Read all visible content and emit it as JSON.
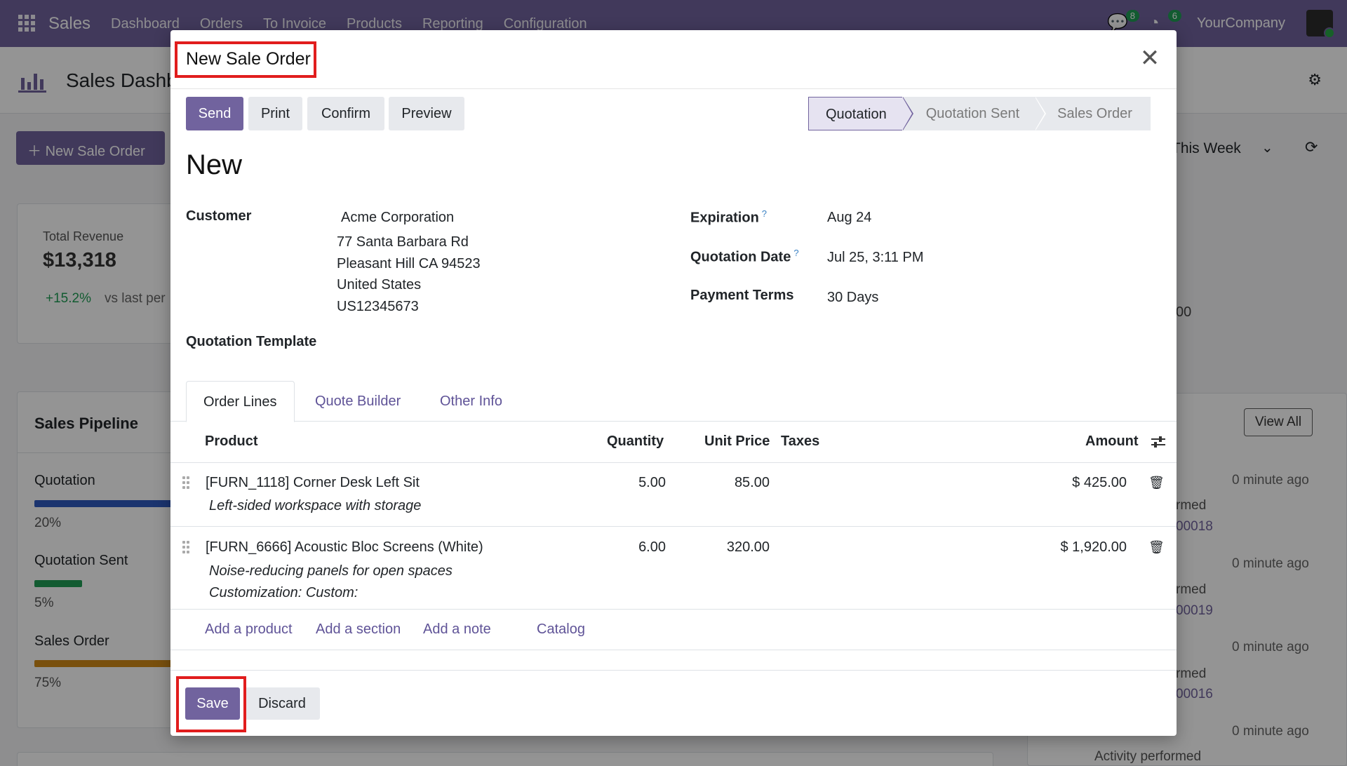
{
  "app": {
    "name": "Sales",
    "menu": [
      "Dashboard",
      "Orders",
      "To Invoice",
      "Products",
      "Reporting",
      "Configuration"
    ],
    "messages_count": "8",
    "activities_count": "6",
    "company": "YourCompany"
  },
  "dashboard": {
    "title": "Sales Dashb",
    "new_order_label": "New Sale Order",
    "period": "This Week",
    "revenue": {
      "label": "Total Revenue",
      "value": "$13,318",
      "delta": "+15.2%",
      "vs": "vs last per"
    },
    "pipeline": {
      "title": "Sales Pipeline",
      "stages": [
        {
          "name": "Quotation",
          "pct": "20%",
          "color": "#2f5bbf"
        },
        {
          "name": "Quotation Sent",
          "pct": "5%",
          "color": "#1f9d55"
        },
        {
          "name": "Sales Order",
          "pct": "75%",
          "color": "#d08b17"
        }
      ]
    },
    "view_all": "View All",
    "partial_number": "00",
    "activities": [
      {
        "time": "0 minute ago",
        "text": "rmed",
        "ref": "00018"
      },
      {
        "time": "0 minute ago",
        "text": "rmed",
        "ref": "00019"
      },
      {
        "time": "0 minute ago",
        "text": "rmed",
        "ref": "00016"
      },
      {
        "time": "0 minute ago",
        "text": "Activity performed",
        "ref": ""
      }
    ]
  },
  "modal": {
    "title": "New Sale Order",
    "buttons": {
      "send": "Send",
      "print": "Print",
      "confirm": "Confirm",
      "preview": "Preview"
    },
    "stages": [
      "Quotation",
      "Quotation Sent",
      "Sales Order"
    ],
    "record_name": "New",
    "customer": {
      "label": "Customer",
      "name": "Acme Corporation",
      "address": [
        "77 Santa Barbara Rd",
        "Pleasant Hill CA 94523",
        "United States",
        "US12345673"
      ]
    },
    "quotation_template_label": "Quotation Template",
    "expiration": {
      "label": "Expiration",
      "help": "?",
      "value": "Aug 24"
    },
    "quotation_date": {
      "label": "Quotation Date",
      "help": "?",
      "value": "Jul 25, 3:11 PM"
    },
    "payment_terms": {
      "label": "Payment Terms",
      "value": "30 Days"
    },
    "tabs": [
      "Order Lines",
      "Quote Builder",
      "Other Info"
    ],
    "columns": {
      "product": "Product",
      "quantity": "Quantity",
      "unit_price": "Unit Price",
      "taxes": "Taxes",
      "amount": "Amount"
    },
    "lines": [
      {
        "product": "[FURN_1118] Corner Desk Left Sit",
        "description": [
          "Left-sided workspace with storage"
        ],
        "quantity": "5.00",
        "unit_price": "85.00",
        "taxes": "",
        "amount": "$ 425.00"
      },
      {
        "product": "[FURN_6666] Acoustic Bloc Screens (White)",
        "description": [
          "Noise-reducing panels for open spaces",
          "Customization: Custom:"
        ],
        "quantity": "6.00",
        "unit_price": "320.00",
        "taxes": "",
        "amount": "$ 1,920.00"
      }
    ],
    "add_links": {
      "product": "Add a product",
      "section": "Add a section",
      "note": "Add a note",
      "catalog": "Catalog"
    },
    "footer": {
      "save": "Save",
      "discard": "Discard"
    },
    "highlight_color": "#e11d1d",
    "accent_color": "#71639e"
  }
}
